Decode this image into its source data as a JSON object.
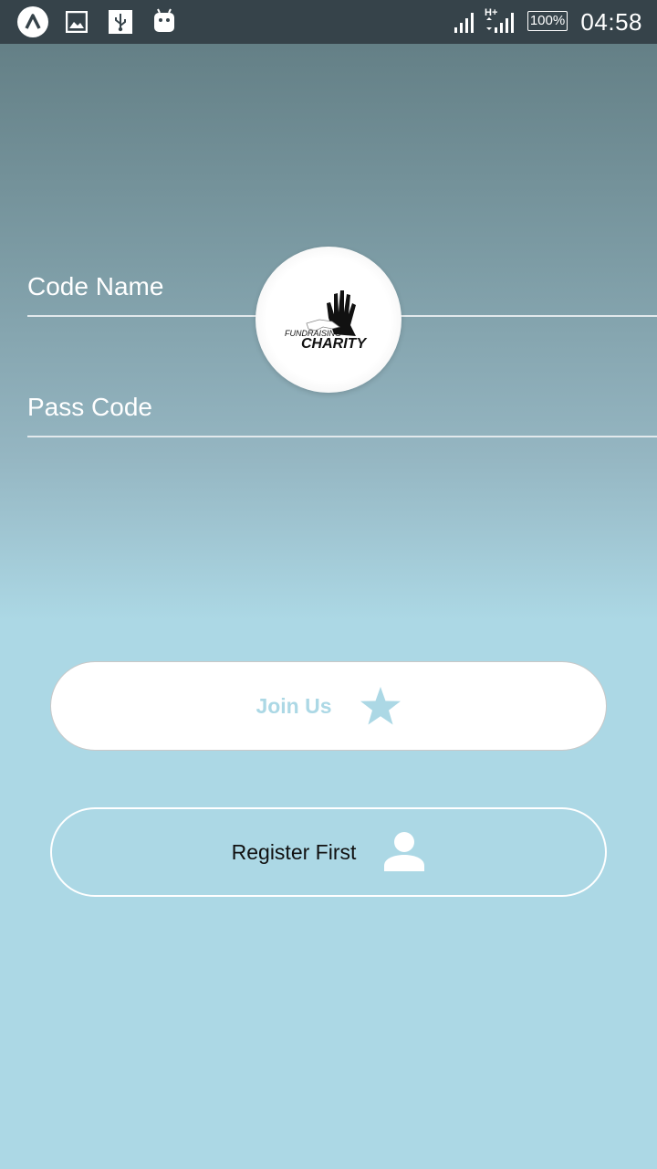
{
  "status_bar": {
    "battery": "100%",
    "time": "04:58",
    "network": "H+",
    "icons": [
      "aspect-launcher-icon",
      "image-icon",
      "usb-icon",
      "android-icon",
      "signal-icon",
      "signal-h-plus-icon",
      "battery-icon"
    ]
  },
  "logo": {
    "line1": "FUNDRAISING",
    "line2": "CHARITY"
  },
  "form": {
    "code_name_label": "Code Name",
    "pass_code_label": "Pass Code"
  },
  "buttons": {
    "join_label": "Join Us",
    "join_icon": "star-icon",
    "register_label": "Register First",
    "register_icon": "person-icon"
  },
  "colors": {
    "accent": "#acd8e5",
    "status_bar": "#36434a"
  }
}
